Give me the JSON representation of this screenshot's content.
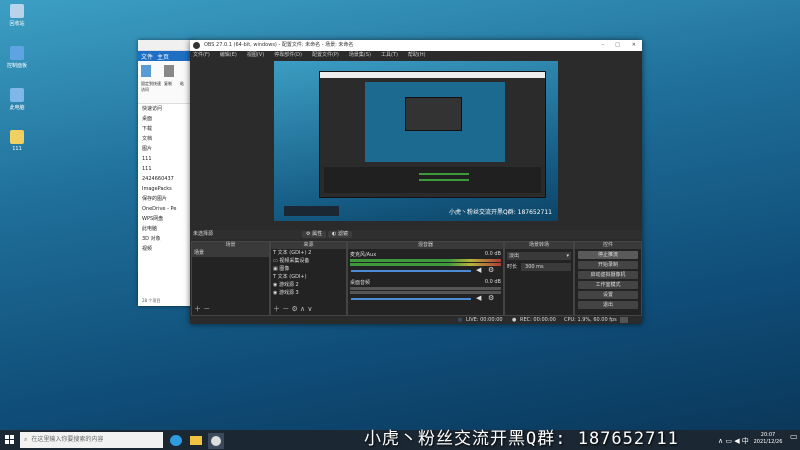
{
  "desktop_icons": [
    {
      "label": "回收站",
      "color": "#b9d4ea"
    },
    {
      "label": "控制面板",
      "color": "#5fa4e2"
    },
    {
      "label": "此电脑",
      "color": "#7fb7e8"
    },
    {
      "label": "111",
      "color": "#f0d060"
    }
  ],
  "explorer": {
    "tabs": [
      "文件",
      "主页"
    ],
    "ribbon_labels": [
      "固定到快速访问",
      "复制",
      "粘"
    ],
    "nav": [
      "快速访问",
      "桌面",
      "下载",
      "文档",
      "图片",
      "111",
      "111",
      "2424660437",
      "ImagePacks",
      "保存的图片",
      "OneDrive - Pe",
      "WPS网盘",
      "此电脑",
      "3D 对象",
      "视频"
    ],
    "status": "28 个项目"
  },
  "obs": {
    "title": "OBS 27.0.1 (64-bit, windows) - 配置文件: 未命名 - 场景: 未命名",
    "menu": [
      "文件(F)",
      "编辑(E)",
      "视图(V)",
      "停靠部件(D)",
      "配置文件(P)",
      "场景集(S)",
      "工具(T)",
      "帮助(H)"
    ],
    "preview_caption": "小虎丶粉丝交流开黑Q群: 187652711",
    "source_toolbar": {
      "label": "未选择源",
      "properties": "属性",
      "filters": "滤镜"
    },
    "docks": {
      "scenes": {
        "title": "场景",
        "items": [
          "场景"
        ]
      },
      "sources": {
        "title": "来源",
        "items": [
          "文本 (GDI+) 2",
          "视频采集设备",
          "图像",
          "文本 (GDI+)",
          "游戏源 2",
          "游戏源 3"
        ]
      },
      "mixer": {
        "title": "混音器",
        "channels": [
          {
            "name": "麦克风/Aux",
            "db": "0.0 dB"
          },
          {
            "name": "桌面音频",
            "db": "0.0 dB"
          }
        ]
      },
      "transitions": {
        "title": "场景转场",
        "type": "淡出",
        "duration_label": "时长",
        "duration": "300 ms"
      },
      "controls": {
        "title": "控件",
        "buttons": [
          "停止推流",
          "开始录制",
          "启动虚拟摄像机",
          "工作室模式",
          "设置",
          "退出"
        ]
      }
    },
    "status": {
      "live": "LIVE: 00:00:00",
      "rec": "REC: 00:00:00",
      "cpu": "CPU: 1.9%, 60.00 fps"
    }
  },
  "taskbar": {
    "search_placeholder": "在这里输入你要搜索的内容",
    "time": "20:07",
    "date": "2021/12/26"
  },
  "banner": "小虎丶粉丝交流开黑Q群: 187652711"
}
